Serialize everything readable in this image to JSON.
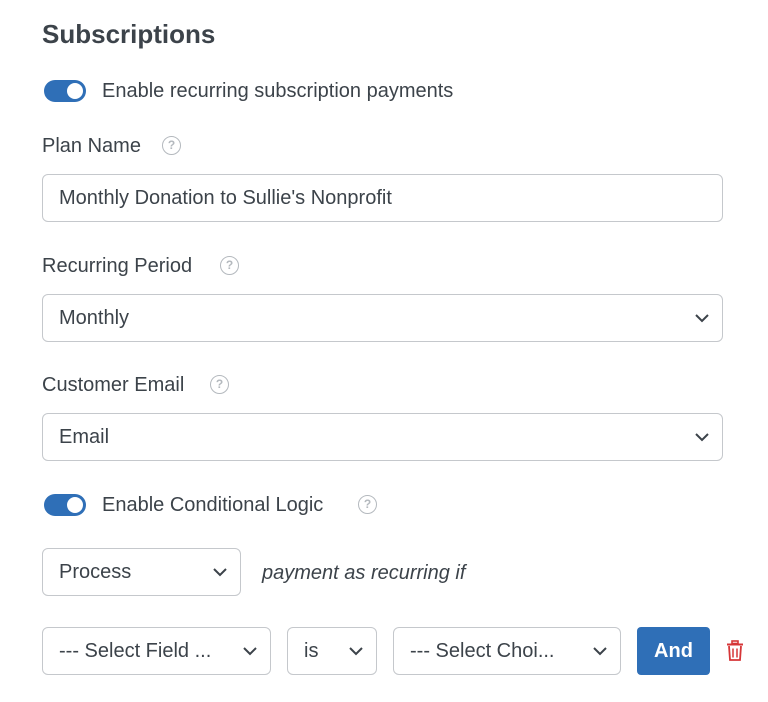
{
  "section": {
    "title": "Subscriptions"
  },
  "recurring": {
    "toggle_label": "Enable recurring subscription payments",
    "enabled": true
  },
  "plan_name": {
    "label": "Plan Name",
    "value": "Monthly Donation to Sullie's Nonprofit"
  },
  "recurring_period": {
    "label": "Recurring Period",
    "selected": "Monthly"
  },
  "customer_email": {
    "label": "Customer Email",
    "selected": "Email"
  },
  "conditional_logic": {
    "toggle_label": "Enable Conditional Logic",
    "enabled": true,
    "action_selected": "Process",
    "action_suffix": "payment as recurring if",
    "rule": {
      "field_selected": "--- Select Field ...",
      "operator_selected": "is",
      "choice_selected": "--- Select Choi...",
      "and_button": "And"
    }
  },
  "colors": {
    "accent": "#2f6fb7",
    "delete": "#d63638",
    "text": "#3c434a",
    "border": "#c5c8cc"
  },
  "icons": {
    "help": "question-circle-icon",
    "chevron": "chevron-down-icon",
    "delete": "trash-icon"
  }
}
